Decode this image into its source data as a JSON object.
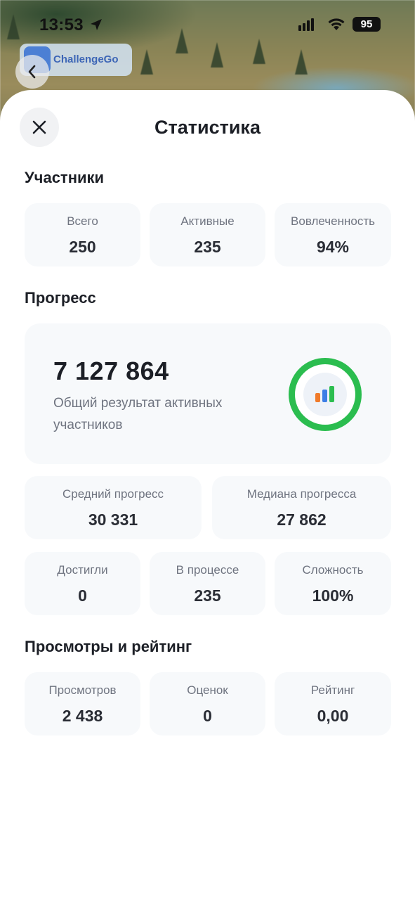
{
  "status_bar": {
    "time": "13:53",
    "battery": "95"
  },
  "brand": {
    "name": "ChallengeGo"
  },
  "sheet": {
    "title": "Статистика"
  },
  "participants": {
    "title": "Участники",
    "cards": [
      {
        "label": "Всего",
        "value": "250"
      },
      {
        "label": "Активные",
        "value": "235"
      },
      {
        "label": "Вовлеченность",
        "value": "94%"
      }
    ]
  },
  "progress": {
    "title": "Прогресс",
    "total_value": "7 127 864",
    "total_desc": "Общий результат активных участников",
    "ring_level": 1.0,
    "ring_color": "#2bbd4f",
    "ring_icon": "bar-chart-icon",
    "bar_icon_colors": [
      "#f07a2a",
      "#3d7ee6",
      "#2bbd4f"
    ],
    "stats_row1": [
      {
        "label": "Средний прогресс",
        "value": "30 331"
      },
      {
        "label": "Медиана прогресса",
        "value": "27 862"
      }
    ],
    "stats_row2": [
      {
        "label": "Достигли",
        "value": "0"
      },
      {
        "label": "В процессе",
        "value": "235"
      },
      {
        "label": "Сложность",
        "value": "100%"
      }
    ]
  },
  "views": {
    "title": "Просмотры и рейтинг",
    "cards": [
      {
        "label": "Просмотров",
        "value": "2 438"
      },
      {
        "label": "Оценок",
        "value": "0"
      },
      {
        "label": "Рейтинг",
        "value": "0,00"
      }
    ]
  }
}
